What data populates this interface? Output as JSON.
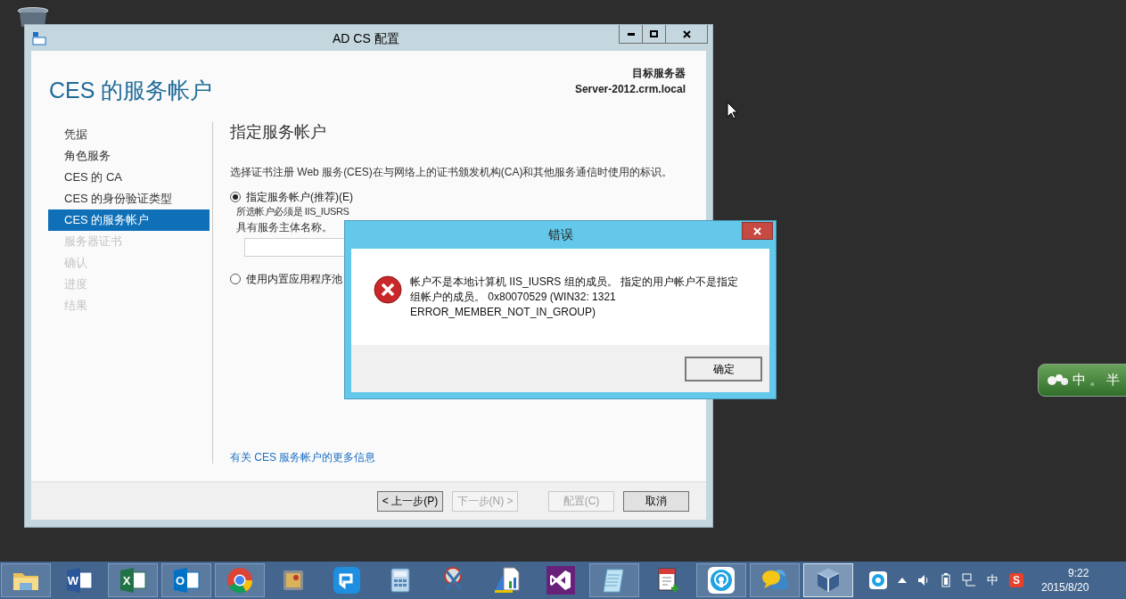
{
  "window": {
    "title": "AD CS 配置"
  },
  "page": {
    "heading": "CES 的服务帐户",
    "target_label": "目标服务器",
    "target_server": "Server-2012.crm.local"
  },
  "steps": [
    {
      "label": "凭据",
      "selected": false,
      "disabled": false
    },
    {
      "label": "角色服务",
      "selected": false,
      "disabled": false
    },
    {
      "label": "CES 的 CA",
      "selected": false,
      "disabled": false
    },
    {
      "label": "CES 的身份验证类型",
      "selected": false,
      "disabled": false
    },
    {
      "label": "CES 的服务帐户",
      "selected": true,
      "disabled": false
    },
    {
      "label": "服务器证书",
      "selected": false,
      "disabled": true
    },
    {
      "label": "确认",
      "selected": false,
      "disabled": true
    },
    {
      "label": "进度",
      "selected": false,
      "disabled": true
    },
    {
      "label": "结果",
      "selected": false,
      "disabled": true
    }
  ],
  "content": {
    "heading": "指定服务帐户",
    "description": "选择证书注册 Web 服务(CES)在与网络上的证书颁发机构(CA)和其他服务通信时使用的标识。",
    "options": [
      {
        "label": "指定服务帐户(推荐)(E)",
        "selected": true,
        "notes": [
          "所选帐户必须是 IIS_IUSRS",
          "具有服务主体名称。"
        ],
        "has_field": true
      },
      {
        "label": "使用内置应用程序池",
        "selected": false,
        "has_field": false
      }
    ],
    "link": "有关 CES 服务帐户的更多信息"
  },
  "buttons": [
    {
      "label": "< 上一步(P)",
      "disabled": false
    },
    {
      "label": "下一步(N) >",
      "disabled": true
    },
    {
      "label": "配置(C)",
      "disabled": true
    },
    {
      "label": "取消",
      "disabled": false
    }
  ],
  "dialog": {
    "title": "错误",
    "message": "帐户不是本地计算机 IIS_IUSRS 组的成员。 指定的用户帐户不是指定组帐户的成员。 0x80070529 (WIN32: 1321 ERROR_MEMBER_NOT_IN_GROUP)",
    "button": "确定"
  },
  "ime_bar": {
    "labels": [
      "中",
      "。",
      "半"
    ]
  },
  "taskbar": {
    "items": [
      {
        "kind": "folder",
        "running": true,
        "selected": false
      },
      {
        "kind": "word",
        "label": "W",
        "running": false,
        "selected": false
      },
      {
        "kind": "excel",
        "label": "X",
        "running": true,
        "selected": false
      },
      {
        "kind": "outlook",
        "label": "O",
        "running": true,
        "selected": false
      },
      {
        "kind": "chrome",
        "running": true,
        "selected": false
      },
      {
        "kind": "safe",
        "running": false,
        "selected": false
      },
      {
        "kind": "blue-app",
        "running": false,
        "selected": false
      },
      {
        "kind": "calculator",
        "running": false,
        "selected": false
      },
      {
        "kind": "scissors",
        "running": false,
        "selected": false
      },
      {
        "kind": "chart-doc",
        "running": false,
        "selected": false
      },
      {
        "kind": "vs",
        "running": false,
        "selected": false
      },
      {
        "kind": "notepad",
        "running": true,
        "selected": false
      },
      {
        "kind": "red-notepad",
        "running": false,
        "selected": false
      },
      {
        "kind": "wifi-app",
        "running": true,
        "selected": false
      },
      {
        "kind": "chat",
        "running": true,
        "selected": false
      },
      {
        "kind": "cube",
        "running": true,
        "selected": true
      }
    ]
  },
  "tray": {
    "ime": "中",
    "sogou": "S",
    "time": "9:22",
    "date": "2015/8/20"
  }
}
